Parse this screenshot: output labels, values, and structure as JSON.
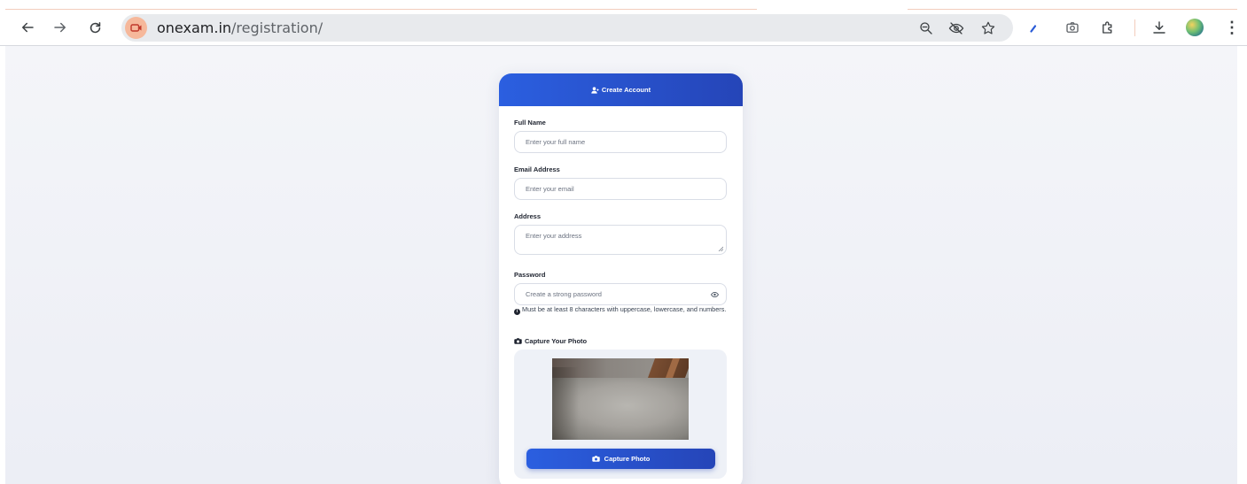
{
  "browser": {
    "url_host": "onexam.in",
    "url_path": "/registration/",
    "icons": [
      "back-arrow-icon",
      "forward-arrow-icon",
      "reload-icon",
      "camera-in-use-icon",
      "zoom-out-icon",
      "tracking-off-eye-icon",
      "bookmark-star-icon",
      "pen-icon",
      "screenshot-camera-icon",
      "extensions-puzzle-icon",
      "download-icon",
      "profile-avatar",
      "more-menu-icon"
    ]
  },
  "form": {
    "header": "Create Account",
    "full_name": {
      "label": "Full Name",
      "placeholder": "Enter your full name"
    },
    "email": {
      "label": "Email Address",
      "placeholder": "Enter your email"
    },
    "address": {
      "label": "Address",
      "placeholder": "Enter your address"
    },
    "password": {
      "label": "Password",
      "placeholder": "Create a strong password"
    },
    "password_hint": "Must be at least 8 characters with uppercase, lowercase, and numbers.",
    "photo_label": "Capture Your Photo",
    "capture_button": "Capture Photo"
  },
  "colors": {
    "accent_start": "#2b5fe0",
    "accent_end": "#2545b8",
    "page_bg": "#f4f5f9"
  }
}
